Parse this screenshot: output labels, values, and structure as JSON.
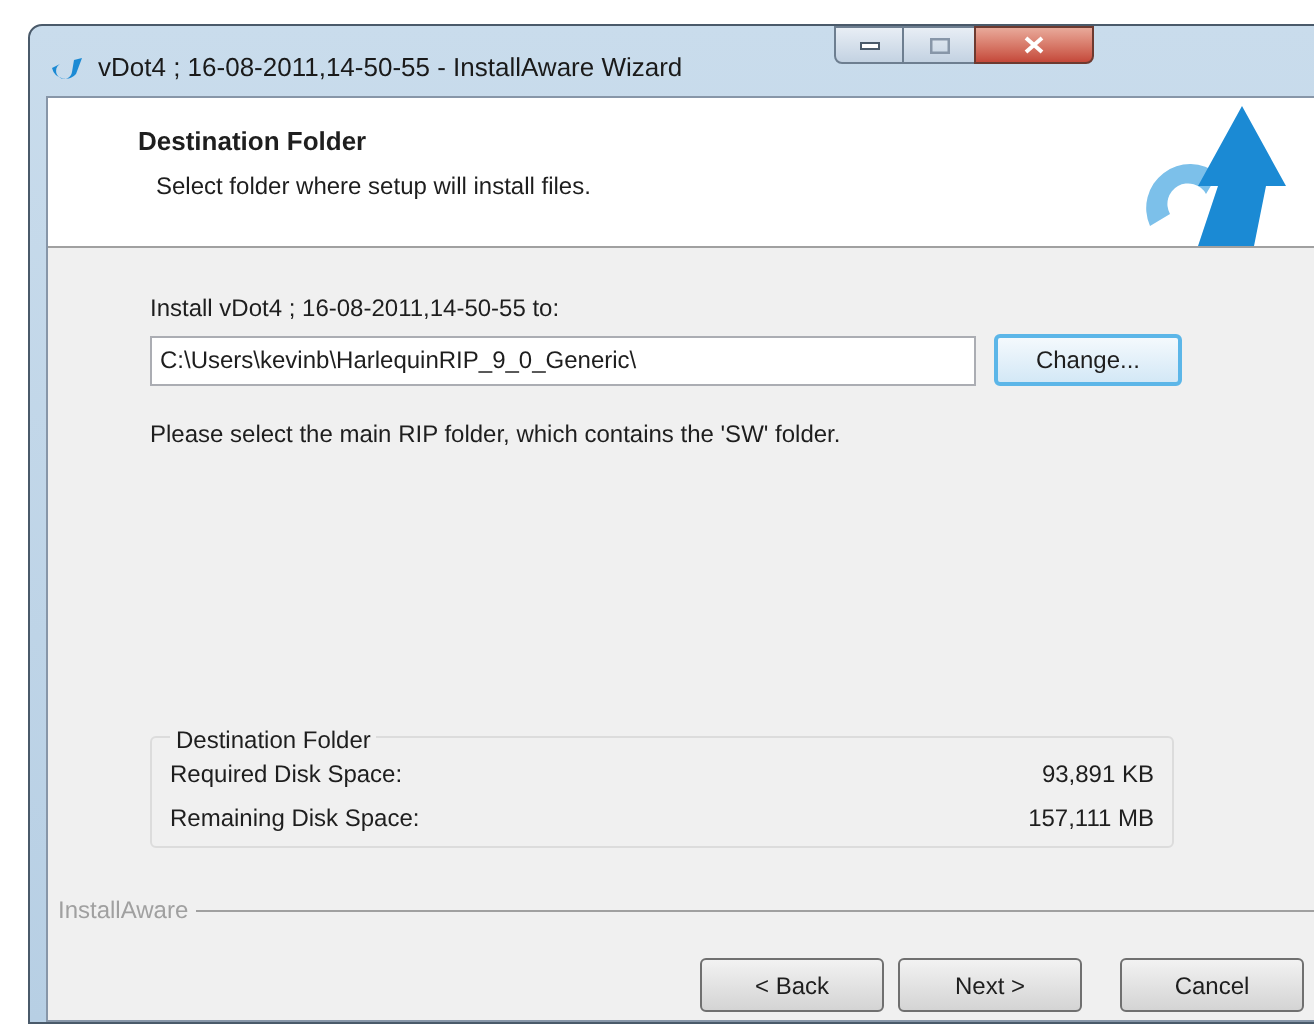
{
  "window": {
    "title": "vDot4 ; 16-08-2011,14-50-55 - InstallAware Wizard"
  },
  "header": {
    "title": "Destination Folder",
    "subtitle": "Select folder where setup will install files."
  },
  "install_label": "Install vDot4 ; 16-08-2011,14-50-55 to:",
  "path_field": {
    "value": "C:\\Users\\kevinb\\HarlequinRIP_9_0_Generic\\"
  },
  "change_button": "Change...",
  "note": "Please select the main RIP folder, which contains the 'SW' folder.",
  "disk_group": {
    "title": "Destination Folder",
    "rows": [
      {
        "label": "Required Disk Space:",
        "value": "93,891 KB"
      },
      {
        "label": "Remaining Disk Space:",
        "value": "157,111 MB"
      }
    ]
  },
  "brand": "InstallAware",
  "buttons": [
    "< Back",
    "Next >",
    "Cancel"
  ]
}
